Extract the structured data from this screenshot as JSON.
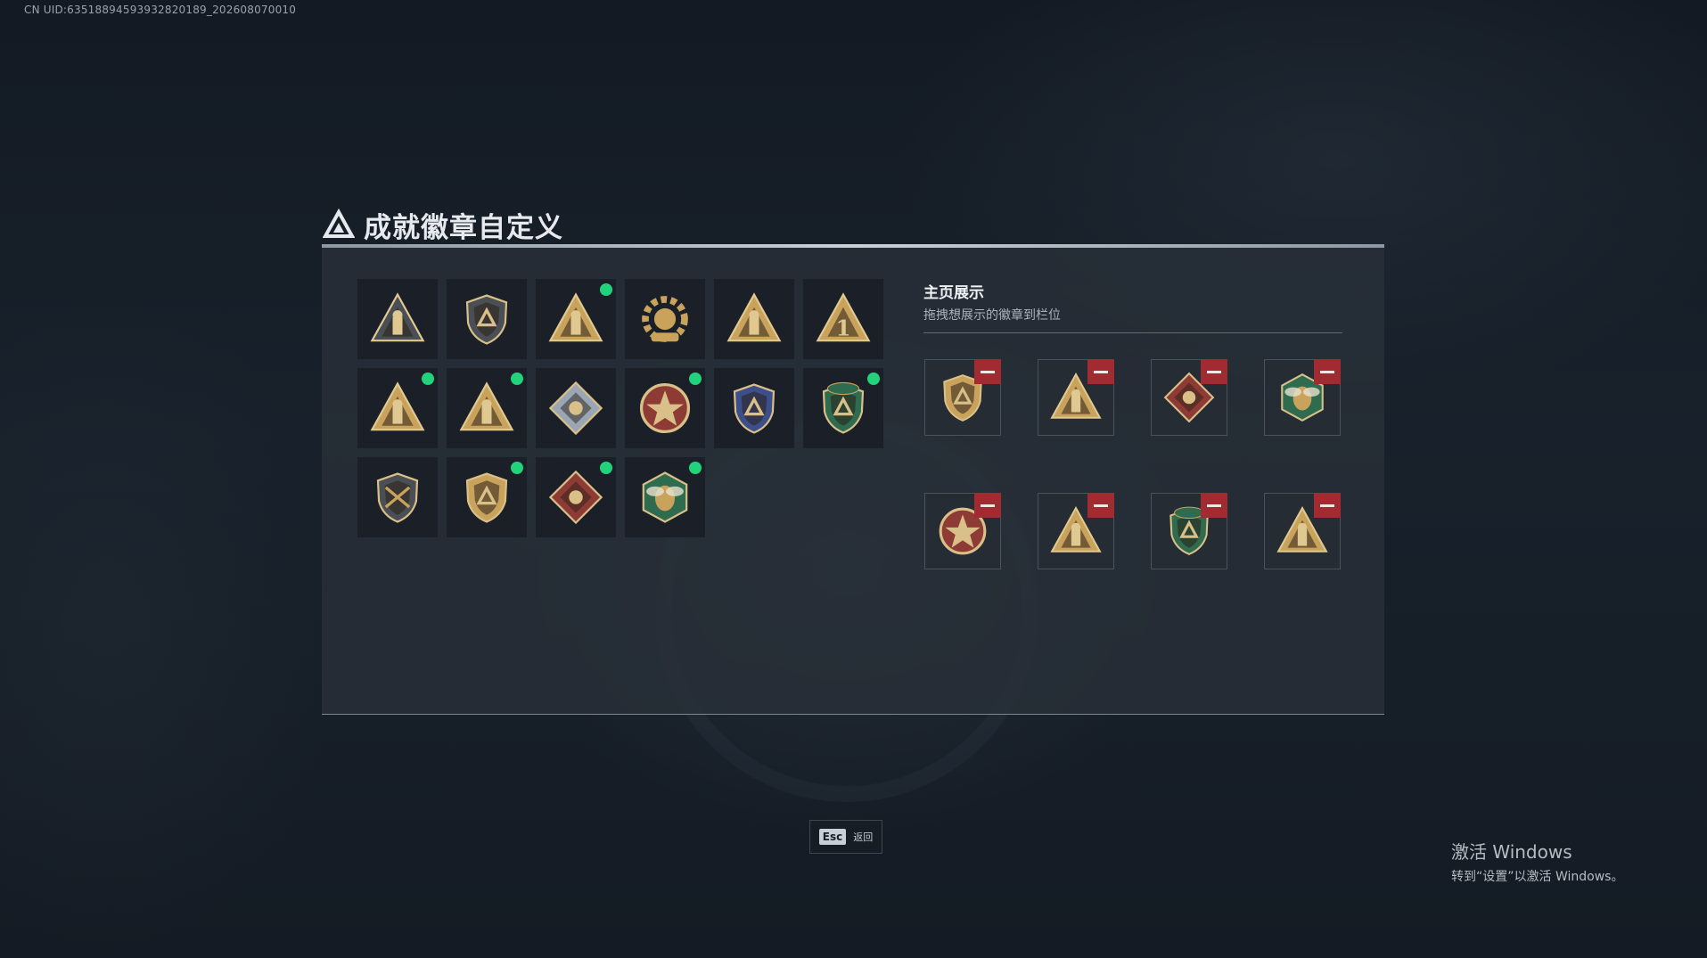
{
  "watermark": {
    "uid": "CN UID:6351889459393282018​9_202608070010"
  },
  "header": {
    "title": "成就徽章自定义"
  },
  "badge_grid": {
    "items": [
      {
        "icon": "shield-triangle-badge-icon",
        "tone": "dark",
        "has_new": false
      },
      {
        "icon": "helicopter-shield-badge-icon",
        "tone": "dark",
        "has_new": false
      },
      {
        "icon": "gold-triangle-badge-icon",
        "tone": "gold",
        "has_new": true
      },
      {
        "icon": "gear-emblem-badge-icon",
        "tone": "gold",
        "has_new": false
      },
      {
        "icon": "wave-triangle-badge-icon",
        "tone": "gold",
        "has_new": false
      },
      {
        "icon": "number-one-triangle-badge-icon",
        "tone": "gold",
        "has_new": false
      },
      {
        "icon": "soldiers-triangle-badge-icon",
        "tone": "gold",
        "has_new": true
      },
      {
        "icon": "rocket-triangle-badge-icon",
        "tone": "gold",
        "has_new": true
      },
      {
        "icon": "crystal-diamond-badge-icon",
        "tone": "silver",
        "has_new": false
      },
      {
        "icon": "star-medal-badge-icon",
        "tone": "red",
        "has_new": true
      },
      {
        "icon": "blue-police-shield-badge-icon",
        "tone": "blue",
        "has_new": false
      },
      {
        "icon": "green-beret-shield-badge-icon",
        "tone": "green",
        "has_new": true
      },
      {
        "icon": "crossed-rifle-shield-badge-icon",
        "tone": "dark",
        "has_new": false
      },
      {
        "icon": "eagle-shield-badge-icon",
        "tone": "gold",
        "has_new": true
      },
      {
        "icon": "wolf-diamond-badge-icon",
        "tone": "red",
        "has_new": true
      },
      {
        "icon": "wasp-hexagon-badge-icon",
        "tone": "green",
        "has_new": true
      }
    ]
  },
  "display": {
    "title": "主页展示",
    "subtitle": "拖拽想展示的徽章到栏位",
    "slots": [
      {
        "icon": "eagle-shield-badge-icon",
        "tone": "gold"
      },
      {
        "icon": "rocket-triangle-badge-icon",
        "tone": "gold"
      },
      {
        "icon": "wolf-diamond-badge-icon",
        "tone": "red"
      },
      {
        "icon": "wasp-hexagon-badge-icon",
        "tone": "green"
      },
      {
        "icon": "star-medal-badge-icon",
        "tone": "red"
      },
      {
        "icon": "gold-triangle-badge-icon",
        "tone": "gold"
      },
      {
        "icon": "green-beret-shield-badge-icon",
        "tone": "green"
      },
      {
        "icon": "soldiers-triangle-badge-icon",
        "tone": "gold"
      }
    ]
  },
  "footer": {
    "esc_key": "Esc",
    "back_label": "返回"
  },
  "windows_activation": {
    "title": "激活 Windows",
    "subtitle": "转到“设置”以激活 Windows。"
  },
  "colors": {
    "new_dot": "#22d37c",
    "remove_button": "#a22b31",
    "panel_bg": "#282f38",
    "gold": "#c9a35c",
    "red": "#8e3a35",
    "green": "#2f6b4e",
    "blue": "#3d4f8a",
    "silver": "#9aa6b4",
    "dark": "#4a4f55"
  }
}
